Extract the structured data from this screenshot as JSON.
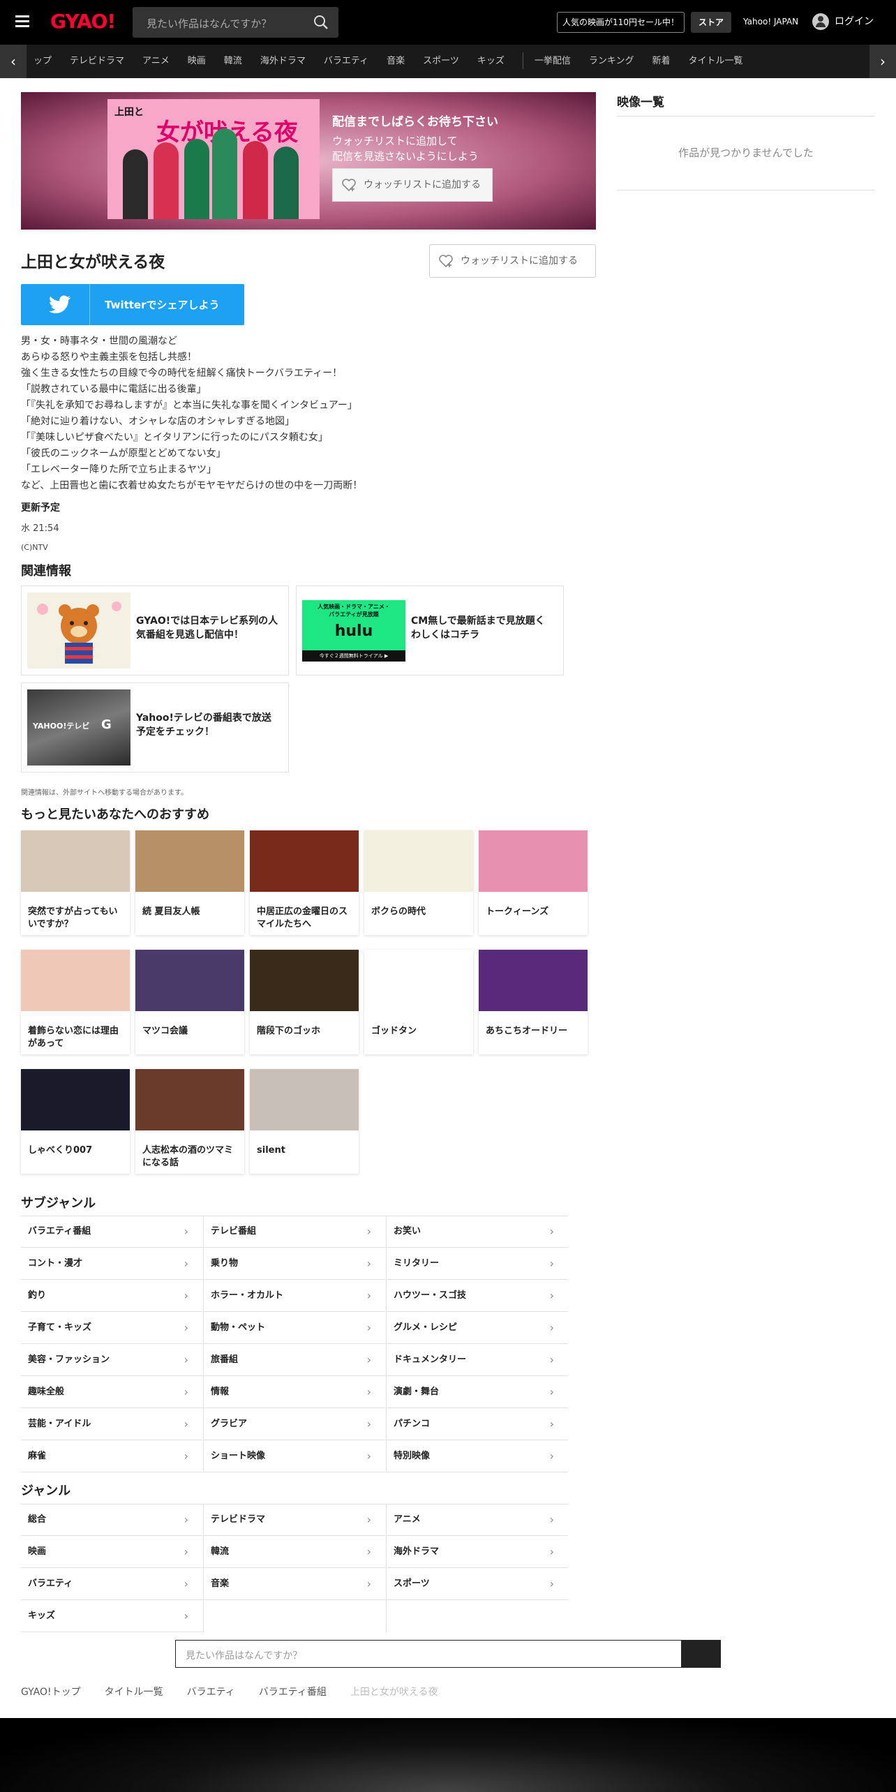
{
  "header": {
    "logo": "GYAO!",
    "search_placeholder": "見たい作品はなんですか？",
    "sale_link": "人気の映画が110円セール中！",
    "store_label": "ストア",
    "yahoo_link": "Yahoo! JAPAN",
    "login_label": "ログイン"
  },
  "nav": {
    "items": [
      "ップ",
      "テレビドラマ",
      "アニメ",
      "映画",
      "韓流",
      "海外ドラマ",
      "バラエティ",
      "音楽",
      "スポーツ",
      "キッズ"
    ],
    "items2": [
      "一挙配信",
      "ランキング",
      "新着",
      "タイトル一覧"
    ]
  },
  "hero": {
    "image_title": "上田と",
    "image_title2": "女が吠える夜",
    "message_title": "配信までしばらくお待ち下さい",
    "message_line1": "ウォッチリストに追加して",
    "message_line2": "配信を見逃さないようにしよう",
    "watchlist_button": "ウォッチリストに追加する"
  },
  "program": {
    "title": "上田と女が吠える夜",
    "watchlist_button": "ウォッチリストに追加する",
    "twitter_button": "Twitterでシェアしよう",
    "description": [
      "男・女・時事ネタ・世間の風潮など",
      "あらゆる怒りや主義主張を包括し共感！",
      "強く生きる女性たちの目線で今の時代を紐解く痛快トークバラエティー！",
      "「説教されている最中に電話に出る後輩」",
      "「『失礼を承知でお尋ねしますが』と本当に失礼な事を聞くインタビュアー」",
      "「絶対に辿り着けない、オシャレな店のオシャレすぎる地図」",
      "「『美味しいピザ食べたい』とイタリアンに行ったのにパスタ頼む女」",
      "「彼氏のニックネームが原型とどめてない女」",
      "「エレベーター降りた所で立ち止まるヤツ」",
      "など、上田晋也と歯に衣着せぬ女たちがモヤモヤだらけの世の中を一刀両断！"
    ],
    "schedule_heading": "更新予定",
    "schedule_value": "水 21:54",
    "copyright": "(C)NTV"
  },
  "related": {
    "heading": "関連情報",
    "items": [
      {
        "text": "GYAO!では日本テレビ系列の人気番組を見逃し配信中！"
      },
      {
        "text": "CM無しで最新話まで見放題くわしくはコチラ",
        "img_text1": "人気映画・ドラマ・アニメ・バラエティが見放題",
        "img_text2": "hulu",
        "img_text3": "今すぐ２週間無料トライアル ▶"
      },
      {
        "text": "Yahoo!テレビの番組表で放送予定をチェック！",
        "img_text1": "YAHOO!テレビ",
        "img_text2": "G"
      }
    ],
    "note": "関連情報は、外部サイトへ移動する場合があります。"
  },
  "recommend": {
    "heading": "もっと見たいあなたへのおすすめ",
    "items": [
      {
        "name": "突然ですが占ってもいいですか？",
        "color": "#d8c8b8"
      },
      {
        "name": "続 夏目友人帳",
        "color": "#b89068"
      },
      {
        "name": "中居正広の金曜日のスマイルたちへ",
        "color": "#7a2a1a"
      },
      {
        "name": "ボクらの時代",
        "color": "#f4f0e0"
      },
      {
        "name": "トークィーンズ",
        "color": "#e890b0"
      },
      {
        "name": "着飾らない恋には理由があって",
        "color": "#f0c8b8"
      },
      {
        "name": "マツコ会議",
        "color": "#4a3a6a"
      },
      {
        "name": "階段下のゴッホ",
        "color": "#3a2a1a"
      },
      {
        "name": "ゴッドタン",
        "color": "#ffffff"
      },
      {
        "name": "あちこちオードリー",
        "color": "#5a2a7a"
      },
      {
        "name": "しゃべくり007",
        "color": "#1a1a2a"
      },
      {
        "name": "人志松本の酒のツマミになる話",
        "color": "#6a3a2a"
      },
      {
        "name": "silent",
        "color": "#c8c0b8"
      }
    ]
  },
  "subgenre": {
    "heading": "サブジャンル",
    "items": [
      "バラエティ番組",
      "テレビ番組",
      "お笑い",
      "コント・漫才",
      "乗り物",
      "ミリタリー",
      "釣り",
      "ホラー・オカルト",
      "ハウツー・スゴ技",
      "子育て・キッズ",
      "動物・ペット",
      "グルメ・レシピ",
      "美容・ファッション",
      "旅番組",
      "ドキュメンタリー",
      "趣味全般",
      "情報",
      "演劇・舞台",
      "芸能・アイドル",
      "グラビア",
      "パチンコ",
      "麻雀",
      "ショート映像",
      "特別映像"
    ]
  },
  "genre": {
    "heading": "ジャンル",
    "items": [
      "総合",
      "テレビドラマ",
      "アニメ",
      "映画",
      "韓流",
      "海外ドラマ",
      "バラエティ",
      "音楽",
      "スポーツ",
      "キッズ"
    ]
  },
  "bottom_search": {
    "placeholder": "見たい作品はなんですか？"
  },
  "breadcrumb": [
    "GYAO!トップ",
    "タイトル一覧",
    "バラエティ",
    "バラエティ番組",
    "上田と女が吠える夜"
  ],
  "sidebar": {
    "title": "映像一覧",
    "empty": "作品が見つかりませんでした"
  },
  "colors": {
    "brand": "#ff0033",
    "twitter": "#1da1f2"
  }
}
